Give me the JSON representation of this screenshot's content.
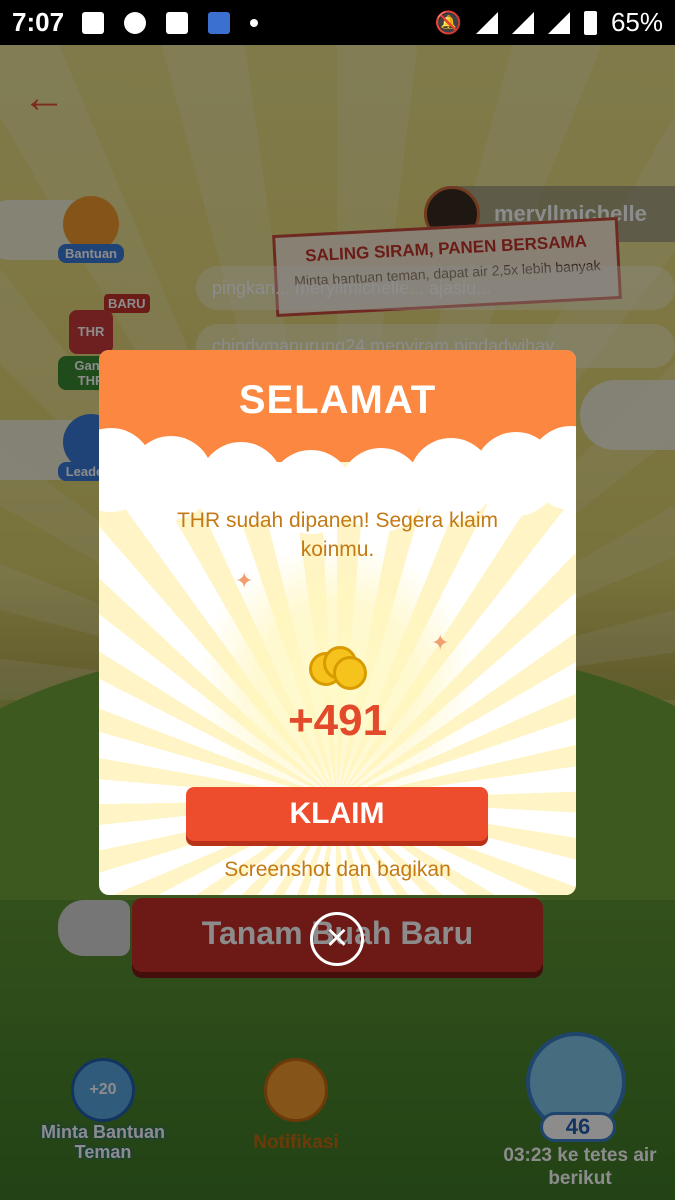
{
  "status_bar": {
    "time": "7:07",
    "battery": "65%"
  },
  "game": {
    "side_buttons": {
      "help": "Bantuan",
      "new_badge": "BARU",
      "thr_badge": "THR",
      "thr_label": "Ganti THR",
      "leaderboard": "Leaderb"
    },
    "friend": {
      "username": "meryllmichelle"
    },
    "banner": {
      "title": "SALING SIRAM, PANEN BERSAMA",
      "subtitle": "Minta bantuan teman, dapat air 2,5x lebih banyak"
    },
    "feed": [
      "pingkan... meryllmichelle... ajasiu...",
      "chindymanurung24 menyiram pindadwihay..."
    ],
    "plant_button": "Tanam Buah Baru",
    "bottom": {
      "help_badge": "+20",
      "help_label": "Minta Bantuan Teman",
      "notif_label": "Notifikasi",
      "drops": "46",
      "timer": "03:23 ke tetes air berikut"
    }
  },
  "modal": {
    "title": "SELAMAT",
    "message": "THR sudah dipanen! Segera klaim koinmu.",
    "reward": "+491",
    "claim_label": "KLAIM",
    "share_label": "Screenshot dan bagikan",
    "close_icon": "×"
  },
  "colors": {
    "accent": "#ee4d2d",
    "header": "#fb8740",
    "message_text": "#c47a14"
  }
}
